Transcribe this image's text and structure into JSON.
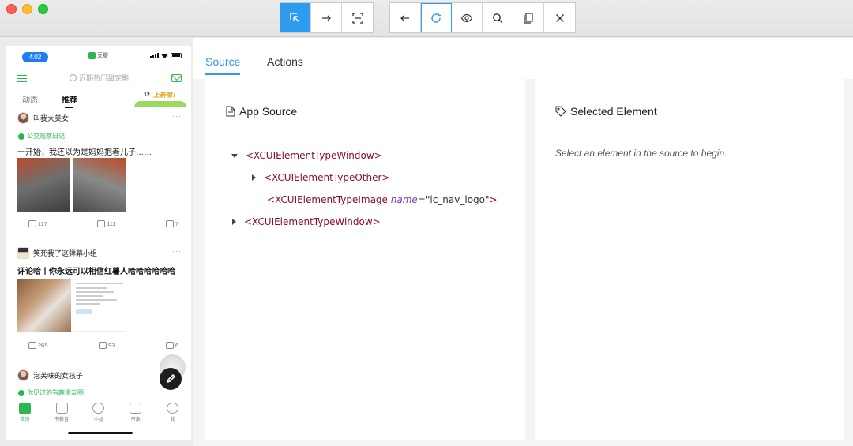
{
  "window": {
    "toolbar_left": [
      "select-element",
      "swipe",
      "tap-by-coordinates"
    ],
    "toolbar_right": [
      "back",
      "refresh",
      "show-hide",
      "search",
      "copy-xml",
      "quit"
    ]
  },
  "phone": {
    "time": "4:02",
    "app_tag": "豆瓣",
    "search_placeholder": "近期热门甜宠剧",
    "tabs": [
      "动态",
      "推荐"
    ],
    "banner_num": "12",
    "banner_text": "上新啦！",
    "posts": [
      {
        "author": "叫我大美女",
        "group": "公交观察日记",
        "title": "一开始，我还以为是妈妈抱着儿子……",
        "likes": "117",
        "comments": "111",
        "reposts": "7"
      },
      {
        "author": "笑死我了这弹幕小组",
        "title": "评论哈丨你永远可以相信红薯人哈哈哈哈哈哈",
        "likes": "265",
        "comments": "93",
        "reposts": "6"
      },
      {
        "author": "泡芙味的女孩子",
        "group": "你见过的有趣朋友圈"
      }
    ],
    "nav": [
      "首页",
      "书影音",
      "小组",
      "市集",
      "我"
    ]
  },
  "inspector": {
    "tabs": [
      "Source",
      "Actions"
    ],
    "source_title": "App Source",
    "selected_title": "Selected Element",
    "hint": "Select an element in the source to begin.",
    "tree": [
      {
        "tag": "<XCUIElementTypeWindow>"
      },
      {
        "tag": "<XCUIElementTypeOther>"
      },
      {
        "tag_open": "<XCUIElementTypeImage",
        "attr_name": "name",
        "attr_eq": "=",
        "attr_value": "\"ic_nav_logo\"",
        "tag_close": ">"
      },
      {
        "tag": "<XCUIElementTypeWindow>"
      }
    ]
  },
  "colors": {
    "accent": "#2d9cf0",
    "douban_green": "#2ab84d",
    "tag_red": "#8b0f2a",
    "attr_purple": "#7d3fbf"
  }
}
